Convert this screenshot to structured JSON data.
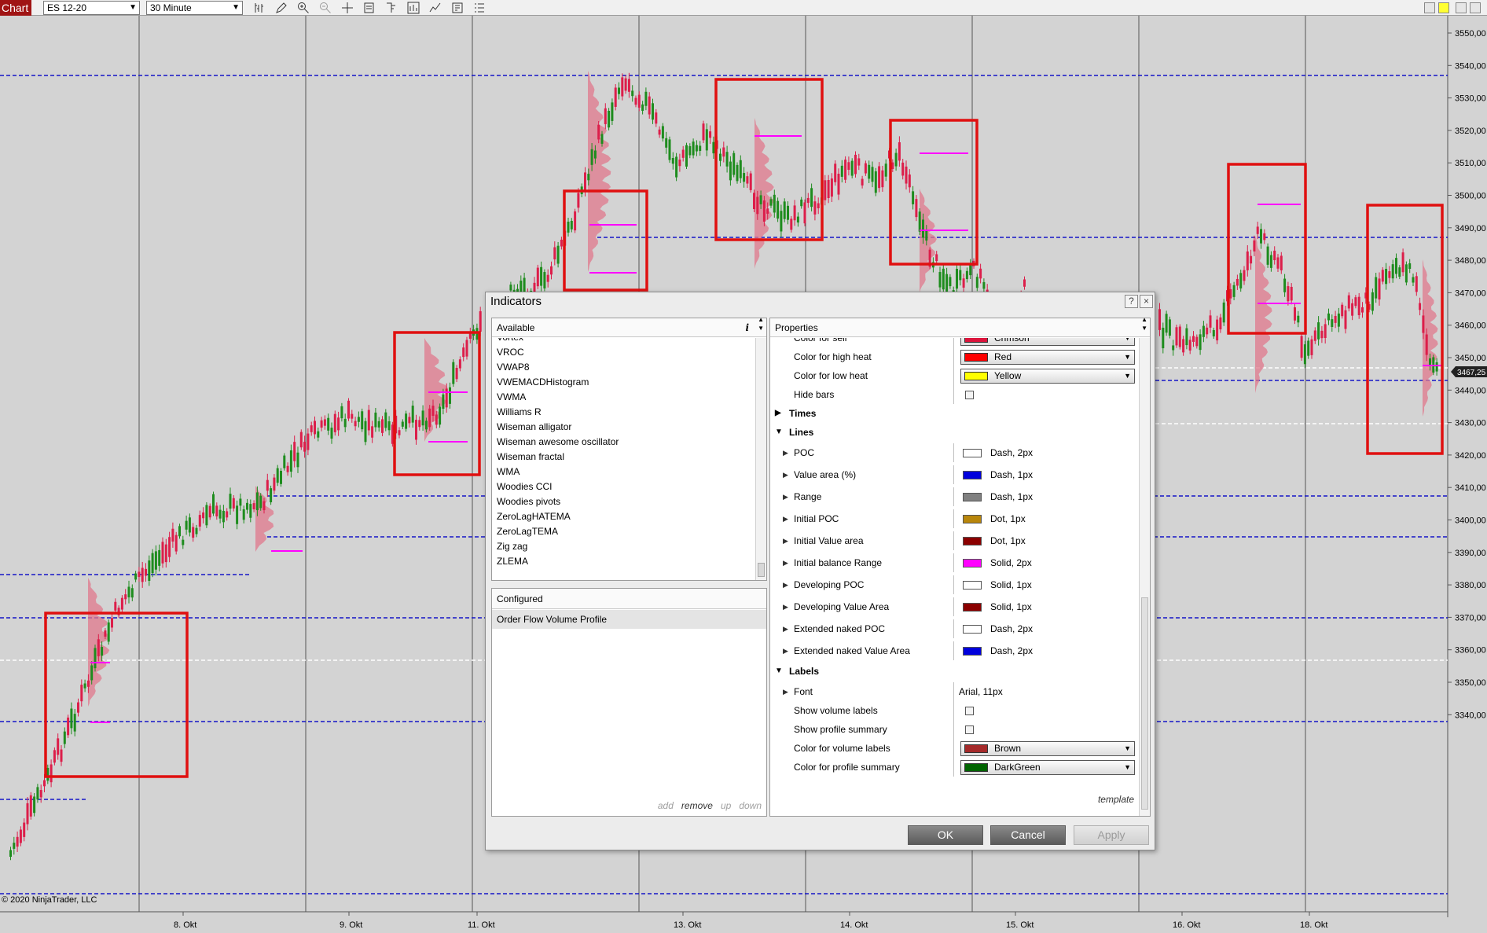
{
  "toolbar": {
    "chart_tab": "Chart",
    "instrument": "ES 12-20",
    "timeframe": "30 Minute",
    "tool_icons": [
      "bar-style-icon",
      "pencil-icon",
      "zoom-in-icon",
      "zoom-out-icon",
      "crosshair-icon",
      "data-box-icon",
      "properties-icon",
      "strategies-icon",
      "indicators-icon",
      "templates-icon",
      "list-icon"
    ]
  },
  "chart": {
    "copyright": "© 2020 NinjaTrader, LLC",
    "price_labels": [
      "3550,00",
      "3540,00",
      "3530,00",
      "3520,00",
      "3510,00",
      "3500,00",
      "3490,00",
      "3480,00",
      "3470,00",
      "3460,00",
      "3450,00",
      "3440,00",
      "3430,00",
      "3420,00",
      "3410,00",
      "3400,00",
      "3390,00",
      "3380,00",
      "3370,00",
      "3360,00",
      "3350,00",
      "3340,00"
    ],
    "current_price": "3467,25",
    "date_labels": [
      "8. Okt",
      "9. Okt",
      "11. Okt",
      "13. Okt",
      "14. Okt",
      "15. Okt",
      "16. Okt",
      "18. Okt"
    ],
    "colors": {
      "up": "#1e8c1e",
      "down": "#dc1e4a",
      "highlight_box": "#e01010",
      "value_area_line": "#1414c8",
      "ib_range": "#ff00ff",
      "profile": "#e0788c"
    }
  },
  "dialog": {
    "title": "Indicators",
    "help_button": "?",
    "close_button": "×",
    "available_header": "Available",
    "info_icon": "i",
    "available_items": [
      "Vortex",
      "VROC",
      "VWAP8",
      "VWEMACDHistogram",
      "VWMA",
      "Williams R",
      "Wiseman alligator",
      "Wiseman awesome oscillator",
      "Wiseman fractal",
      "WMA",
      "Woodies CCI",
      "Woodies pivots",
      "ZeroLagHATEMA",
      "ZeroLagTEMA",
      "Zig zag",
      "ZLEMA"
    ],
    "configured_header": "Configured",
    "configured_items": [
      "Order Flow Volume Profile"
    ],
    "configured_actions": {
      "add": "add",
      "remove": "remove",
      "up": "up",
      "down": "down"
    },
    "properties_header": "Properties",
    "properties": {
      "color_for_sell": {
        "label": "Color for sell",
        "value": "Crimson",
        "color": "#dc143c"
      },
      "color_high_heat": {
        "label": "Color for high heat",
        "value": "Red",
        "color": "#ff0000"
      },
      "color_low_heat": {
        "label": "Color for low heat",
        "value": "Yellow",
        "color": "#ffff00"
      },
      "hide_bars": {
        "label": "Hide bars"
      },
      "times": {
        "label": "Times"
      },
      "lines": {
        "label": "Lines"
      },
      "poc": {
        "label": "POC",
        "value": "Dash, 2px",
        "color": "#ffffff"
      },
      "value_area": {
        "label": "Value area (%)",
        "value": "Dash, 1px",
        "color": "#0000dc"
      },
      "range": {
        "label": "Range",
        "value": "Dash, 1px",
        "color": "#808080"
      },
      "initial_poc": {
        "label": "Initial POC",
        "value": "Dot, 1px",
        "color": "#b8860b"
      },
      "initial_value_area": {
        "label": "Initial Value area",
        "value": "Dot, 1px",
        "color": "#8b0000"
      },
      "initial_balance_range": {
        "label": "Initial balance Range",
        "value": "Solid, 2px",
        "color": "#ff00ff"
      },
      "developing_poc": {
        "label": "Developing POC",
        "value": "Solid, 1px",
        "color": "#ffffff"
      },
      "developing_value_area": {
        "label": "Developing Value Area",
        "value": "Solid, 1px",
        "color": "#8b0000"
      },
      "extended_naked_poc": {
        "label": "Extended naked POC",
        "value": "Dash, 2px",
        "color": "#ffffff"
      },
      "extended_naked_value_area": {
        "label": "Extended naked Value Area",
        "value": "Dash, 2px",
        "color": "#0000dc"
      },
      "labels": {
        "label": "Labels"
      },
      "font": {
        "label": "Font",
        "value": "Arial, 11px"
      },
      "show_volume_labels": {
        "label": "Show volume labels"
      },
      "show_profile_summary": {
        "label": "Show profile summary"
      },
      "color_volume_labels": {
        "label": "Color for volume labels",
        "value": "Brown",
        "color": "#a52a2a"
      },
      "color_profile_summary": {
        "label": "Color for profile summary",
        "value": "DarkGreen",
        "color": "#006400"
      }
    },
    "template_link": "template",
    "buttons": {
      "ok": "OK",
      "cancel": "Cancel",
      "apply": "Apply"
    }
  }
}
